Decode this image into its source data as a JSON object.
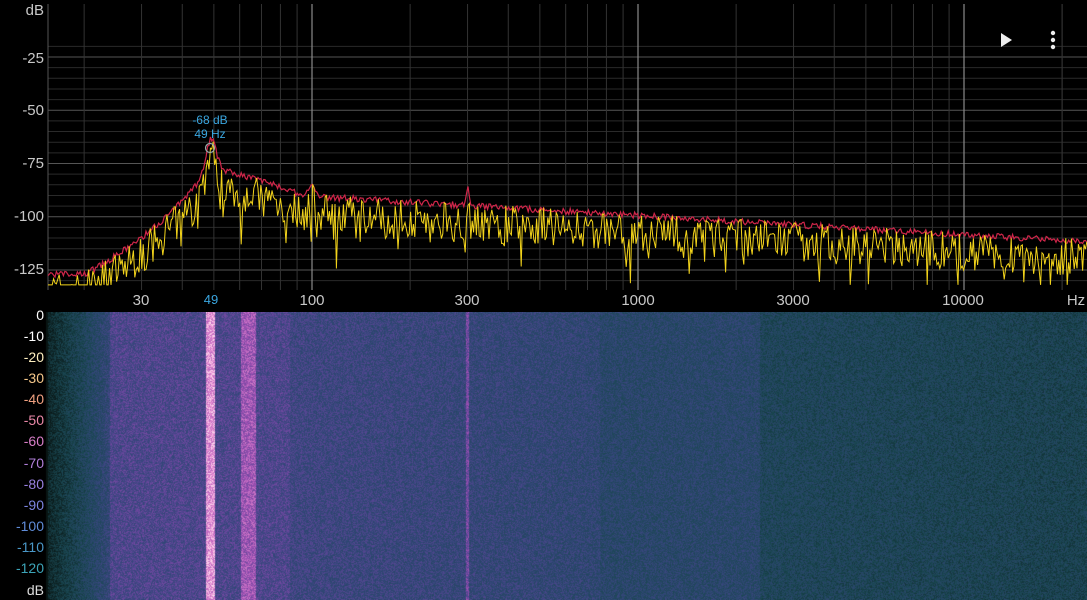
{
  "spectrum": {
    "y_unit": "dB",
    "y_ticks": [
      "-25",
      "-50",
      "-75",
      "-100",
      "-125"
    ],
    "x_unit": "Hz",
    "x_ticks": [
      "30",
      "100",
      "300",
      "1000",
      "3000",
      "10000"
    ],
    "peak": {
      "db_label": "-68 dB",
      "hz_label": "49 Hz",
      "axis_label": "49"
    },
    "colors": {
      "live": "#f2d31b",
      "hold": "#d0264a",
      "grid": "#3a3a3a",
      "marker": "#3aa6e0"
    }
  },
  "spectrogram": {
    "scale_ticks": [
      "0",
      "-10",
      "-20",
      "-30",
      "-40",
      "-50",
      "-60",
      "-70",
      "-80",
      "-90",
      "-100",
      "-110",
      "-120"
    ],
    "scale_colors": [
      "#ffffff",
      "#ffffff",
      "#fff0c0",
      "#f6c88a",
      "#f0a080",
      "#ea88a8",
      "#d87ec8",
      "#b07ed8",
      "#9880e0",
      "#7c84e0",
      "#5f8cd8",
      "#4a98c8",
      "#3ca4b8"
    ],
    "unit": "dB"
  },
  "toolbar": {
    "play_icon": "play-icon",
    "menu_icon": "more-vert-icon"
  }
}
